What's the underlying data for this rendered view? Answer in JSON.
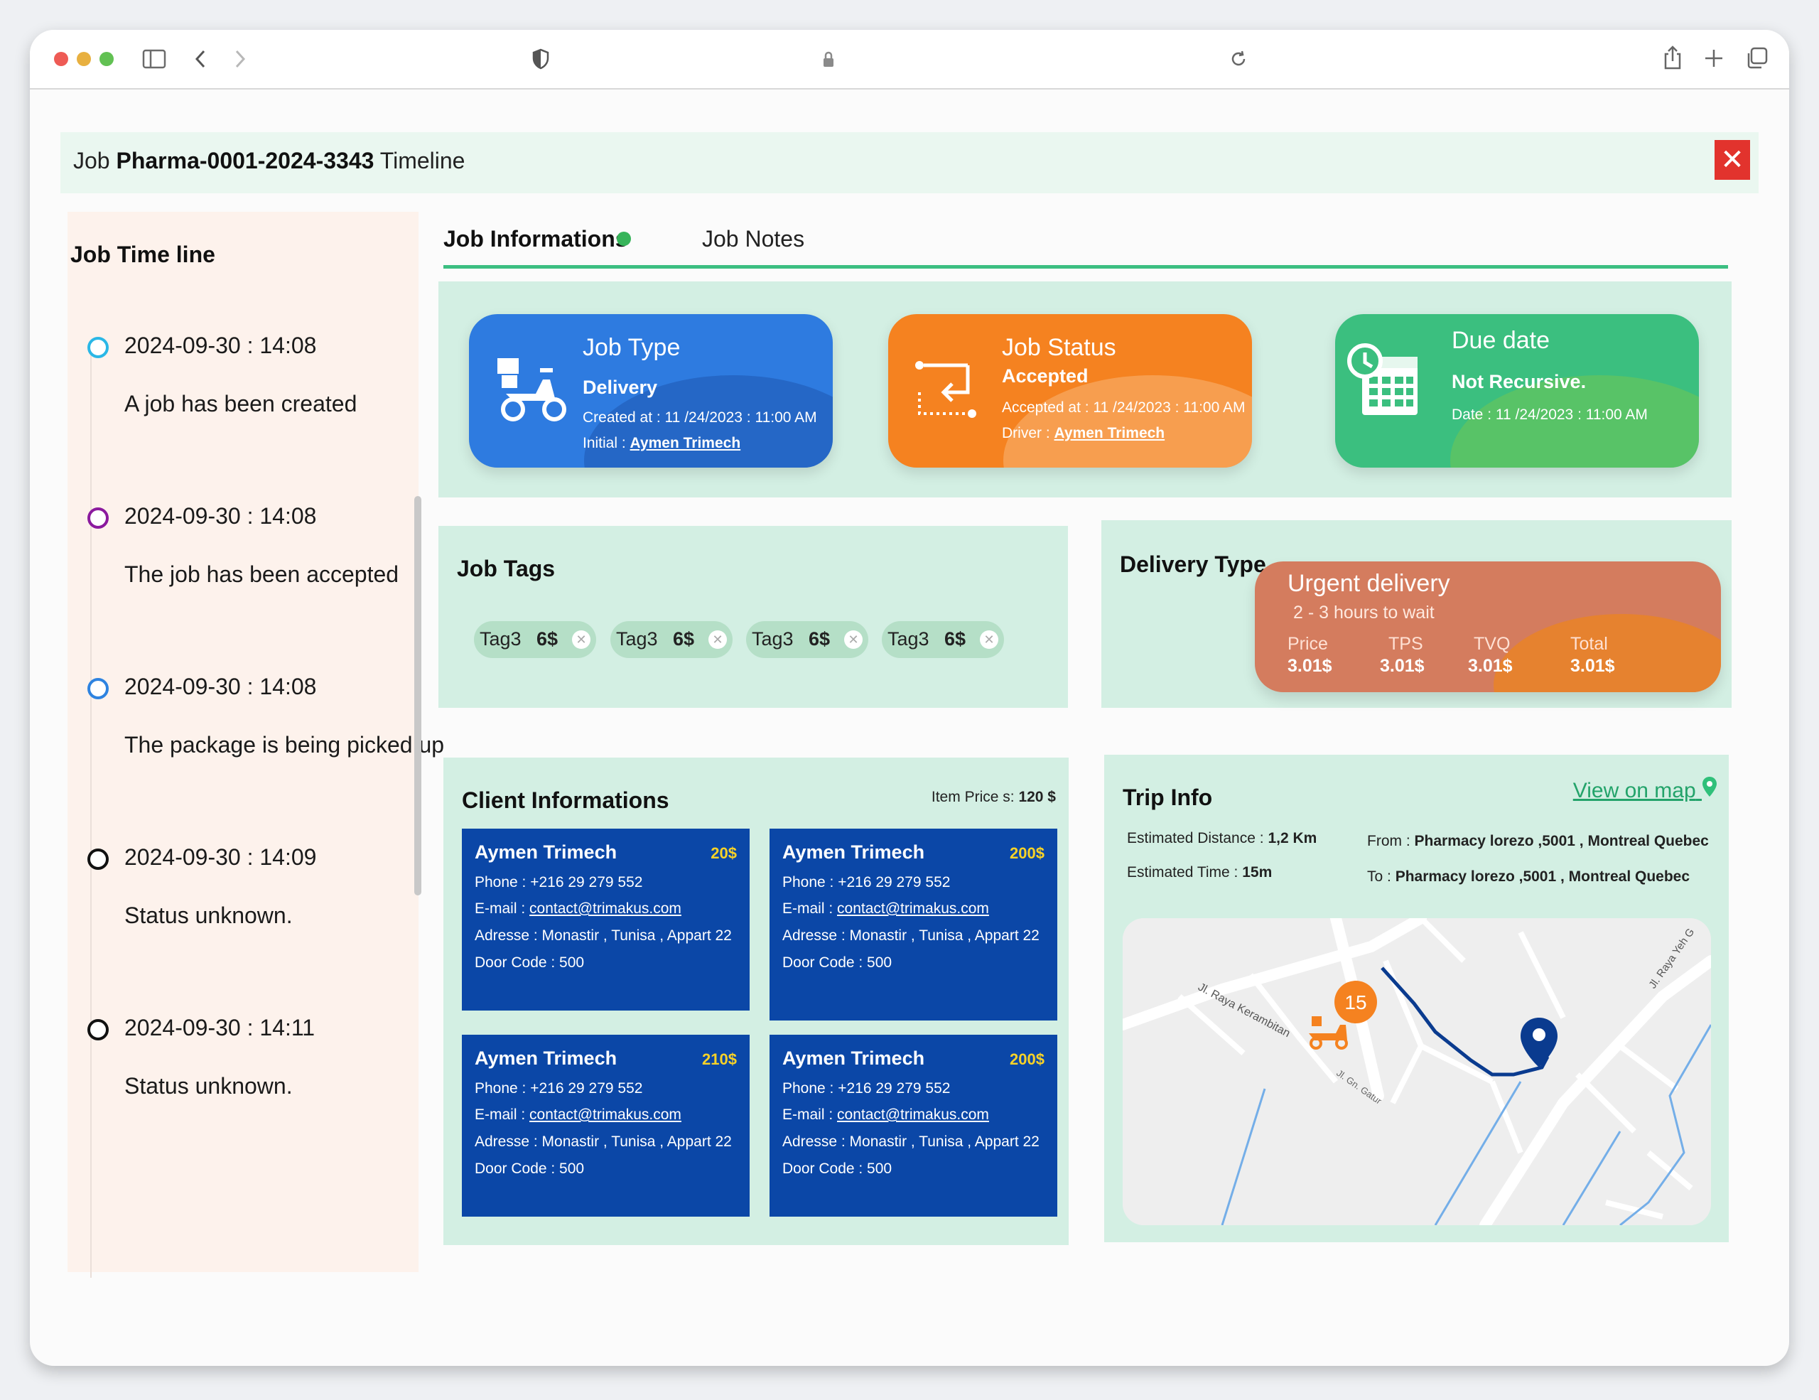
{
  "header": {
    "prefix": "Job",
    "job_id": "Pharma-0001-2024-3343",
    "suffix": "Timeline",
    "close_glyph": "✕"
  },
  "timeline": {
    "title": "Job Time line",
    "items": [
      {
        "time": "2024-09-30 : 14:08",
        "text": "A job has been created",
        "color": "#2ab7e6"
      },
      {
        "time": "2024-09-30 : 14:08",
        "text": "The job has been accepted",
        "color": "#8b1a9e"
      },
      {
        "time": "2024-09-30 : 14:08",
        "text": "The package is being picked up",
        "color": "#2e83e0"
      },
      {
        "time": "2024-09-30 : 14:09",
        "text": "Status unknown.",
        "color": "#111111"
      },
      {
        "time": "2024-09-30 : 14:11",
        "text": "Status unknown.",
        "color": "#111111"
      }
    ]
  },
  "tabs": {
    "active": "Job Informations",
    "other": "Job Notes"
  },
  "cards": {
    "job_type": {
      "title": "Job Type",
      "value": "Delivery",
      "created": "Created at : 11 /24/2023 : 11:00 AM",
      "initial_label": "Initial :",
      "initial_name": "Aymen Trimech",
      "icon": "scooter-icon"
    },
    "job_status": {
      "title": "Job Status",
      "value": "Accepted",
      "accepted": "Accepted at : 11 /24/2023 : 11:00 AM",
      "driver_label": "Driver :",
      "driver_name": "Aymen Trimech",
      "icon": "route-icon"
    },
    "due_date": {
      "title": "Due date",
      "value": "Not Recursive.",
      "date": "Date : 11 /24/2023 : 11:00 AM",
      "icon": "calendar-clock-icon"
    }
  },
  "job_tags": {
    "title": "Job Tags",
    "tags": [
      {
        "name": "Tag3",
        "value": "6$"
      },
      {
        "name": "Tag3",
        "value": "6$"
      },
      {
        "name": "Tag3",
        "value": "6$"
      },
      {
        "name": "Tag3",
        "value": "6$"
      }
    ],
    "remove_glyph": "✕"
  },
  "delivery_type": {
    "title": "Delivery Type",
    "name": "Urgent delivery",
    "wait": "2 - 3 hours to wait",
    "columns": [
      {
        "label": "Price",
        "value": "3.01$"
      },
      {
        "label": "TPS",
        "value": "3.01$"
      },
      {
        "label": "TVQ",
        "value": "3.01$"
      },
      {
        "label": "Total",
        "value": "3.01$"
      }
    ]
  },
  "client_info": {
    "title": "Client Informations",
    "item_price_label": "Item Price s:",
    "item_price_value": "120 $",
    "clients": [
      {
        "name": "Aymen Trimech",
        "amount": "20$",
        "phone": "Phone : +216 29 279 552",
        "email_label": "E-mail :",
        "email": "contact@trimakus.com",
        "address": "Adresse : Monastir , Tunisa , Appart 22",
        "door": "Door Code : 500"
      },
      {
        "name": "Aymen Trimech",
        "amount": "200$",
        "phone": "Phone : +216 29 279 552",
        "email_label": "E-mail :",
        "email": "contact@trimakus.com",
        "address": "Adresse : Monastir , Tunisa , Appart 22",
        "door": "Door Code : 500"
      },
      {
        "name": "Aymen Trimech",
        "amount": "210$",
        "phone": "Phone : +216 29 279 552",
        "email_label": "E-mail :",
        "email": "contact@trimakus.com",
        "address": "Adresse : Monastir , Tunisa , Appart 22",
        "door": "Door Code : 500"
      },
      {
        "name": "Aymen Trimech",
        "amount": "200$",
        "phone": "Phone : +216 29 279 552",
        "email_label": "E-mail :",
        "email": "contact@trimakus.com",
        "address": "Adresse : Monastir , Tunisa , Appart 22",
        "door": "Door Code : 500"
      }
    ]
  },
  "trip_info": {
    "title": "Trip Info",
    "view_map": "View on map",
    "distance_label": "Estimated Distance :",
    "distance_value": "1,2 Km",
    "time_label": "Estimated Time :",
    "time_value": "15m",
    "from_label": "From :",
    "from_value": "Pharmacy lorezo ,5001 , Montreal Quebec",
    "to_label": "To :",
    "to_value": "Pharmacy lorezo ,5001 , Montreal Quebec",
    "map": {
      "badge": "15",
      "street1": "Jl. Raya Kerambitan",
      "street2": "Jl. Gn. Gatur",
      "street3": "Jl. Raya Yeh G"
    }
  },
  "colors": {
    "accent_green": "#3cbf82",
    "panel_bg": "#d3efe3",
    "job_type": "#2e7be0",
    "job_status": "#f58220",
    "due_date": "#3bbf7f",
    "client_card": "#0b47a7",
    "close": "#e2332d"
  }
}
